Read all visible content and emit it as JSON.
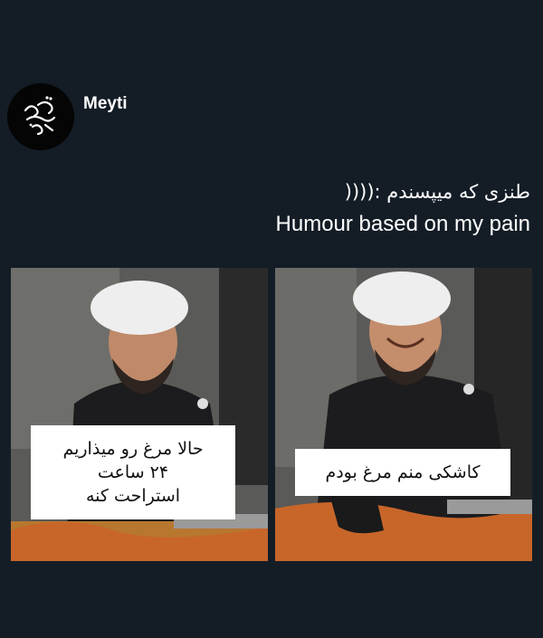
{
  "post": {
    "author": "Meyti",
    "avatar_icon": "calligraphy-logo-icon",
    "caption_fa": "طنزی که میپسندم :((((",
    "caption_en": "Humour based on my pain"
  },
  "meme": {
    "panel_left": {
      "lines": [
        "حالا مرغ رو میذاریم",
        "۲۴ ساعت",
        "استراحت کنه"
      ]
    },
    "panel_right": {
      "text": "کاشکی منم مرغ بودم"
    }
  },
  "colors": {
    "background": "#141d26",
    "text": "#ffffff"
  }
}
